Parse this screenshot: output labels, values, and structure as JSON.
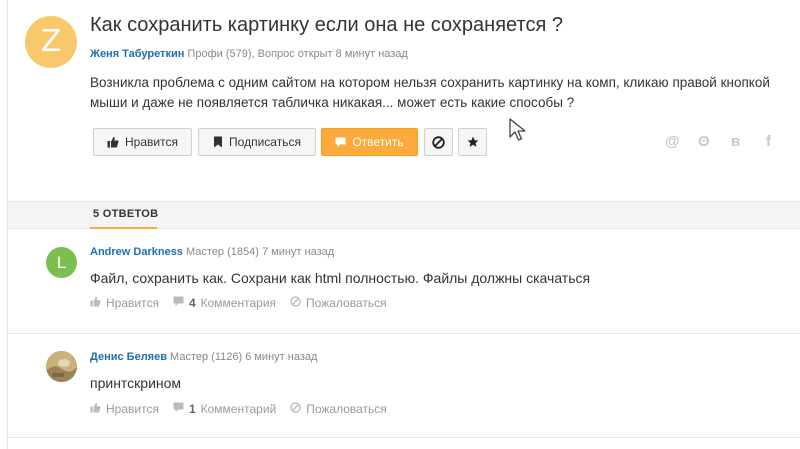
{
  "question": {
    "avatar_letter": "Z",
    "avatar_color": "#f7c96b",
    "title": "Как сохранить картинку если она не сохраняется ?",
    "author": "Женя Табуреткин",
    "author_info": "Профи (579), Вопрос открыт 8 минут назад",
    "text": "Возникла проблема с одним сайтом на котором нельзя сохранить картинку на комп, кликаю правой кнопкой мыши и даже не появляется табличка никакая... может есть какие способы ?"
  },
  "actions": {
    "like_label": "Нравится",
    "subscribe_label": "Подписаться",
    "answer_label": "Ответить",
    "accent_color": "#fbaa3b"
  },
  "share": {
    "mail": "@",
    "ok": "ʘ",
    "vk": "в",
    "fb": "f"
  },
  "answers_header": {
    "count_label": "5 ОТВЕТОВ"
  },
  "answers": [
    {
      "avatar_letter": "L",
      "author": "Andrew Darkness",
      "author_info": "Мастер (1854) 7 минут назад",
      "text": "Файл, сохранить как. Сохрани как html полностью. Файлы должны скачаться",
      "like_label": "Нравится",
      "comments_count": "4",
      "comments_label": "Комментария",
      "report_label": "Пожаловаться"
    },
    {
      "author": "Денис Беляев",
      "author_info": "Мастер (1126) 6 минут назад",
      "text": "принтскрином",
      "like_label": "Нравится",
      "comments_count": "1",
      "comments_label": "Комментарий",
      "report_label": "Пожаловаться"
    }
  ]
}
